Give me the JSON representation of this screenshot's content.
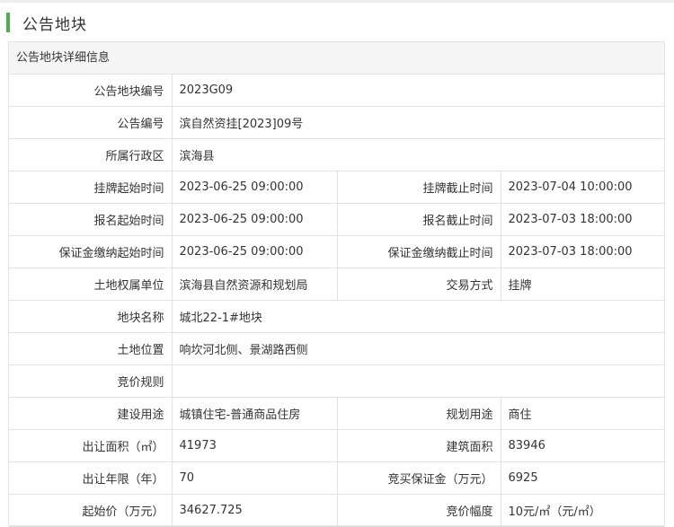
{
  "page": {
    "title": "公告地块",
    "accent_color": "#4cae4c"
  },
  "panel": {
    "heading": "公告地块详细信息"
  },
  "rows": [
    {
      "label": "公告地块编号",
      "value": "2023G09"
    },
    {
      "label": "公告编号",
      "value": "滨自然资挂[2023]09号"
    },
    {
      "label": "所属行政区",
      "value": "滨海县"
    },
    {
      "label": "挂牌起始时间",
      "value": "2023-06-25 09:00:00",
      "label2": "挂牌截止时间",
      "value2": "2023-07-04 10:00:00"
    },
    {
      "label": "报名起始时间",
      "value": "2023-06-25 09:00:00",
      "label2": "报名截止时间",
      "value2": "2023-07-03 18:00:00"
    },
    {
      "label": "保证金缴纳起始时间",
      "value": "2023-06-25 09:00:00",
      "label2": "保证金缴纳截止时间",
      "value2": "2023-07-03 18:00:00"
    },
    {
      "label": "土地权属单位",
      "value": "滨海县自然资源和规划局",
      "label2": "交易方式",
      "value2": "挂牌"
    },
    {
      "label": "地块名称",
      "value": "城北22-1#地块"
    },
    {
      "label": "土地位置",
      "value": "响坎河北侧、景湖路西侧"
    },
    {
      "label": "竞价规则",
      "value": ""
    },
    {
      "label": "建设用途",
      "value": "城镇住宅-普通商品住房",
      "label2": "规划用途",
      "value2": "商住"
    },
    {
      "label": "出让面积（㎡）",
      "value": "41973",
      "label2": "建筑面积",
      "value2": "83946"
    },
    {
      "label": "出让年限（年）",
      "value": "70",
      "label2": "竞买保证金（万元）",
      "value2": "6925"
    },
    {
      "label": "起始价（万元）",
      "value": "34627.725",
      "label2": "竞价幅度",
      "value2": "10元/㎡（元/㎡）"
    }
  ]
}
